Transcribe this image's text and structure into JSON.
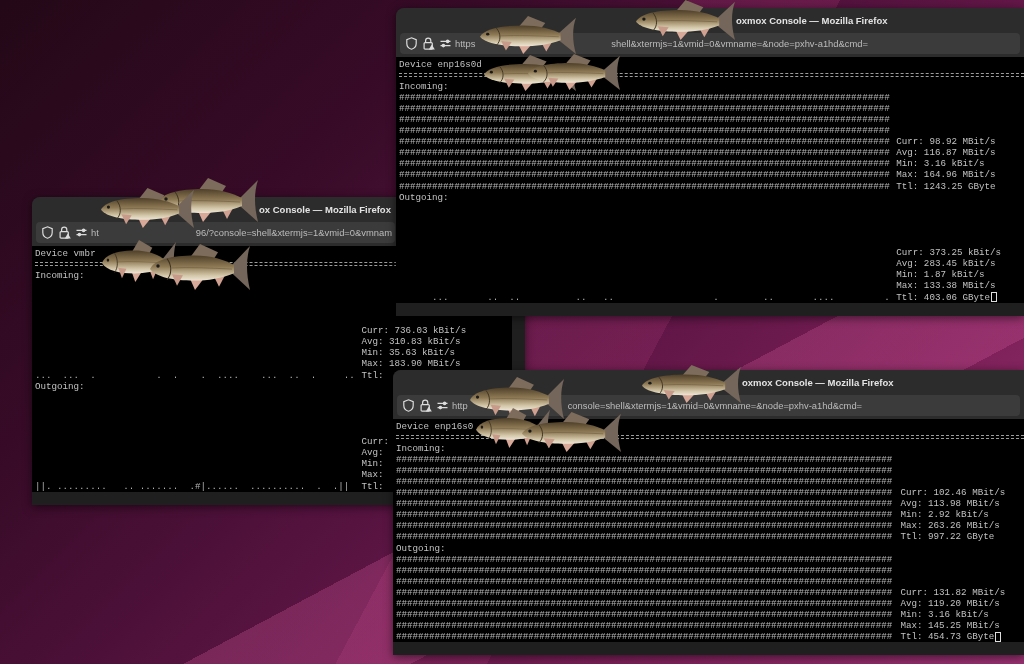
{
  "windows": [
    {
      "title": "oxmox Console — Mozilla Firefox",
      "url_start": "https",
      "url_rest": "shell&xtermjs=1&vmid=0&vmname=&node=pxhv-a1hd&cmd=",
      "device": "Device enp16s0d",
      "sections": [
        {
          "label": "Incoming:",
          "graph_rows": [
            "#########################################################################################",
            "#########################################################################################",
            "#########################################################################################",
            "#########################################################################################",
            "#########################################################################################",
            "#########################################################################################",
            "#########################################################################################",
            "#########################################################################################",
            "#########################################################################################"
          ],
          "stats": [
            "Curr: 98.92 MBit/s",
            "Avg: 116.87 MBit/s",
            "Min: 3.16 kBit/s",
            "Max: 164.96 MBit/s",
            "Ttl: 1243.25 GByte"
          ]
        },
        {
          "label": "Outgoing:",
          "graph_rows": [
            "      ...       ..  ..          ..   ..                  .        ..       ....         ."
          ],
          "stats": [
            "Curr: 373.25 kBit/s",
            "Avg: 283.45 kBit/s",
            "Min: 1.87 kBit/s",
            "Max: 133.38 MBit/s",
            "Ttl: 403.06 GByte"
          ]
        }
      ],
      "cursor": true
    },
    {
      "title": "ox Console — Mozilla Firefox",
      "url_start": "ht",
      "url_rest": "96/?console=shell&xtermjs=1&vmid=0&vmnam",
      "device": "Device vmbr",
      "sections": [
        {
          "label": "Incoming:",
          "graph_rows": [
            "...  ...  .           .  .    .  ....    ...  ..  .     .."
          ],
          "stats": [
            "Curr: 736.03 kBit/s",
            "Avg: 310.83 kBit/s",
            "Min: 35.63 kBit/s",
            "Max: 183.90 MBit/s",
            "Ttl:"
          ]
        },
        {
          "label": "Outgoing:",
          "graph_rows": [
            "||. .........   .. .......  .#|......  ..........  .  .||"
          ],
          "stats": [
            "Curr:",
            "Avg:",
            "Min:",
            "Max:",
            "Ttl:"
          ]
        }
      ],
      "cursor": false
    },
    {
      "title": "oxmox Console — Mozilla Firefox",
      "url_start": "http",
      "url_rest": "console=shell&xtermjs=1&vmid=0&vmname=&node=pxhv-a1hd&cmd=",
      "device": "Device enp16s0",
      "sections": [
        {
          "label": "Incoming:",
          "graph_rows": [
            "##########################################################################################",
            "##########################################################################################",
            "##########################################################################################",
            "##########################################################################################",
            "##########################################################################################",
            "##########################################################################################",
            "##########################################################################################",
            "##########################################################################################"
          ],
          "stats": [
            "Curr: 102.46 MBit/s",
            "Avg: 113.98 MBit/s",
            "Min: 2.92 kBit/s",
            "Max: 263.26 MBit/s",
            "Ttl: 997.22 GByte"
          ]
        },
        {
          "label": "Outgoing:",
          "graph_rows": [
            "##########################################################################################",
            "##########################################################################################",
            "##########################################################################################",
            "##########################################################################################",
            "##########################################################################################",
            "##########################################################################################",
            "##########################################################################################",
            "##########################################################################################"
          ],
          "stats": [
            "Curr: 131.82 MBit/s",
            "Avg: 119.20 MBit/s",
            "Min: 3.16 kBit/s",
            "Max: 145.25 MBit/s",
            "Ttl: 454.73 GByte"
          ]
        }
      ],
      "cursor": true
    }
  ]
}
